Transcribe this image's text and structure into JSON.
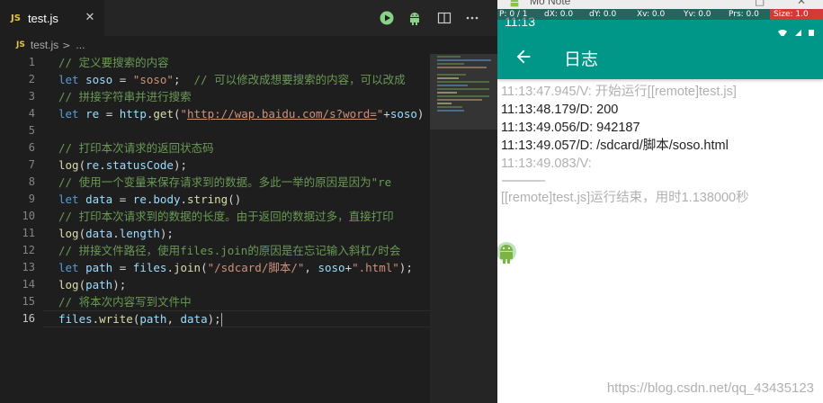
{
  "editor": {
    "tab": {
      "badge": "JS",
      "title": "test.js",
      "close": "✕"
    },
    "breadcrumb": {
      "badge": "JS",
      "file": "test.js",
      "sep": ">",
      "rest": "..."
    },
    "line_numbers": [
      "1",
      "2",
      "3",
      "4",
      "5",
      "6",
      "7",
      "8",
      "9",
      "10",
      "11",
      "12",
      "13",
      "14",
      "15",
      "16"
    ],
    "active_line": "16",
    "code": [
      [
        {
          "t": "// 定义要搜索的内容",
          "c": "c-com"
        }
      ],
      [
        {
          "t": "let",
          "c": "c-kw"
        },
        {
          "t": " ",
          "c": ""
        },
        {
          "t": "soso",
          "c": "c-var"
        },
        {
          "t": " = ",
          "c": ""
        },
        {
          "t": "\"soso\"",
          "c": "c-str"
        },
        {
          "t": ";  ",
          "c": ""
        },
        {
          "t": "// 可以修改成想要搜索的内容，可以改成",
          "c": "c-com"
        }
      ],
      [
        {
          "t": "// 拼接字符串并进行搜索",
          "c": "c-com"
        }
      ],
      [
        {
          "t": "let",
          "c": "c-kw"
        },
        {
          "t": " ",
          "c": ""
        },
        {
          "t": "re",
          "c": "c-var"
        },
        {
          "t": " = ",
          "c": ""
        },
        {
          "t": "http",
          "c": "c-var"
        },
        {
          "t": ".",
          "c": ""
        },
        {
          "t": "get",
          "c": "c-fn"
        },
        {
          "t": "(",
          "c": ""
        },
        {
          "t": "\"",
          "c": "c-str"
        },
        {
          "t": "http://wap.baidu.com/s?word=",
          "c": "c-url"
        },
        {
          "t": "\"",
          "c": "c-str"
        },
        {
          "t": "+",
          "c": ""
        },
        {
          "t": "soso",
          "c": "c-var"
        },
        {
          "t": ")",
          "c": ""
        }
      ],
      [],
      [
        {
          "t": "// 打印本次请求的返回状态码",
          "c": "c-com"
        }
      ],
      [
        {
          "t": "log",
          "c": "c-fn"
        },
        {
          "t": "(",
          "c": ""
        },
        {
          "t": "re",
          "c": "c-var"
        },
        {
          "t": ".",
          "c": ""
        },
        {
          "t": "statusCode",
          "c": "c-var"
        },
        {
          "t": ");",
          "c": ""
        }
      ],
      [
        {
          "t": "// 使用一个变量来保存请求到的数据。多此一举的原因是因为\"re",
          "c": "c-com"
        }
      ],
      [
        {
          "t": "let",
          "c": "c-kw"
        },
        {
          "t": " ",
          "c": ""
        },
        {
          "t": "data",
          "c": "c-var"
        },
        {
          "t": " = ",
          "c": ""
        },
        {
          "t": "re",
          "c": "c-var"
        },
        {
          "t": ".",
          "c": ""
        },
        {
          "t": "body",
          "c": "c-var"
        },
        {
          "t": ".",
          "c": ""
        },
        {
          "t": "string",
          "c": "c-fn"
        },
        {
          "t": "()",
          "c": ""
        }
      ],
      [
        {
          "t": "// 打印本次请求到的数据的长度。由于返回的数据过多，直接打印",
          "c": "c-com"
        }
      ],
      [
        {
          "t": "log",
          "c": "c-fn"
        },
        {
          "t": "(",
          "c": ""
        },
        {
          "t": "data",
          "c": "c-var"
        },
        {
          "t": ".",
          "c": ""
        },
        {
          "t": "length",
          "c": "c-var"
        },
        {
          "t": ");",
          "c": ""
        }
      ],
      [
        {
          "t": "// 拼接文件路径，使用files.join的原因是在忘记输入斜杠/时会",
          "c": "c-com"
        }
      ],
      [
        {
          "t": "let",
          "c": "c-kw"
        },
        {
          "t": " ",
          "c": ""
        },
        {
          "t": "path",
          "c": "c-var"
        },
        {
          "t": " = ",
          "c": ""
        },
        {
          "t": "files",
          "c": "c-var"
        },
        {
          "t": ".",
          "c": ""
        },
        {
          "t": "join",
          "c": "c-fn"
        },
        {
          "t": "(",
          "c": ""
        },
        {
          "t": "\"/sdcard/脚本/\"",
          "c": "c-str"
        },
        {
          "t": ", ",
          "c": ""
        },
        {
          "t": "soso",
          "c": "c-var"
        },
        {
          "t": "+",
          "c": ""
        },
        {
          "t": "\".html\"",
          "c": "c-str"
        },
        {
          "t": ");",
          "c": ""
        }
      ],
      [
        {
          "t": "log",
          "c": "c-fn"
        },
        {
          "t": "(",
          "c": ""
        },
        {
          "t": "path",
          "c": "c-var"
        },
        {
          "t": ");",
          "c": ""
        }
      ],
      [
        {
          "t": "// 将本次内容写到文件中",
          "c": "c-com"
        }
      ],
      [
        {
          "t": "files",
          "c": "c-var"
        },
        {
          "t": ".",
          "c": ""
        },
        {
          "t": "write",
          "c": "c-fn"
        },
        {
          "t": "(",
          "c": ""
        },
        {
          "t": "path",
          "c": "c-var"
        },
        {
          "t": ", ",
          "c": ""
        },
        {
          "t": "data",
          "c": "c-var"
        },
        {
          "t": ");",
          "c": ""
        }
      ]
    ]
  },
  "phone": {
    "emulator_title": "Mo Note",
    "emulator_controls": [
      "□",
      "✕"
    ],
    "status_time": "11:13",
    "pointer_location": [
      "P: 0 / 1",
      "dX: 0.0",
      "dY: 0.0",
      "Xv: 0.0",
      "Yv: 0.0",
      "Prs: 0.0",
      "Size: 1.0"
    ],
    "toolbar_title": "日志",
    "log": [
      {
        "text": "11:13:47.945/V: 开始运行[[remote]test.js]",
        "level": "V"
      },
      {
        "text": "11:13:48.179/D: 200",
        "level": "D"
      },
      {
        "text": "11:13:49.056/D: 942187",
        "level": "D"
      },
      {
        "text": "11:13:49.057/D: /sdcard/脚本/soso.html",
        "level": "D"
      },
      {
        "text": "11:13:49.083/V: ",
        "level": "V"
      }
    ],
    "log_end": "[[remote]test.js]运行结束，用时1.138000秒",
    "watermark": "https://blog.csdn.net/qq_43435123"
  },
  "colors": {
    "accent_teal": "#009688",
    "editor_bg": "#1e1e1e",
    "run_green": "#89d185"
  }
}
